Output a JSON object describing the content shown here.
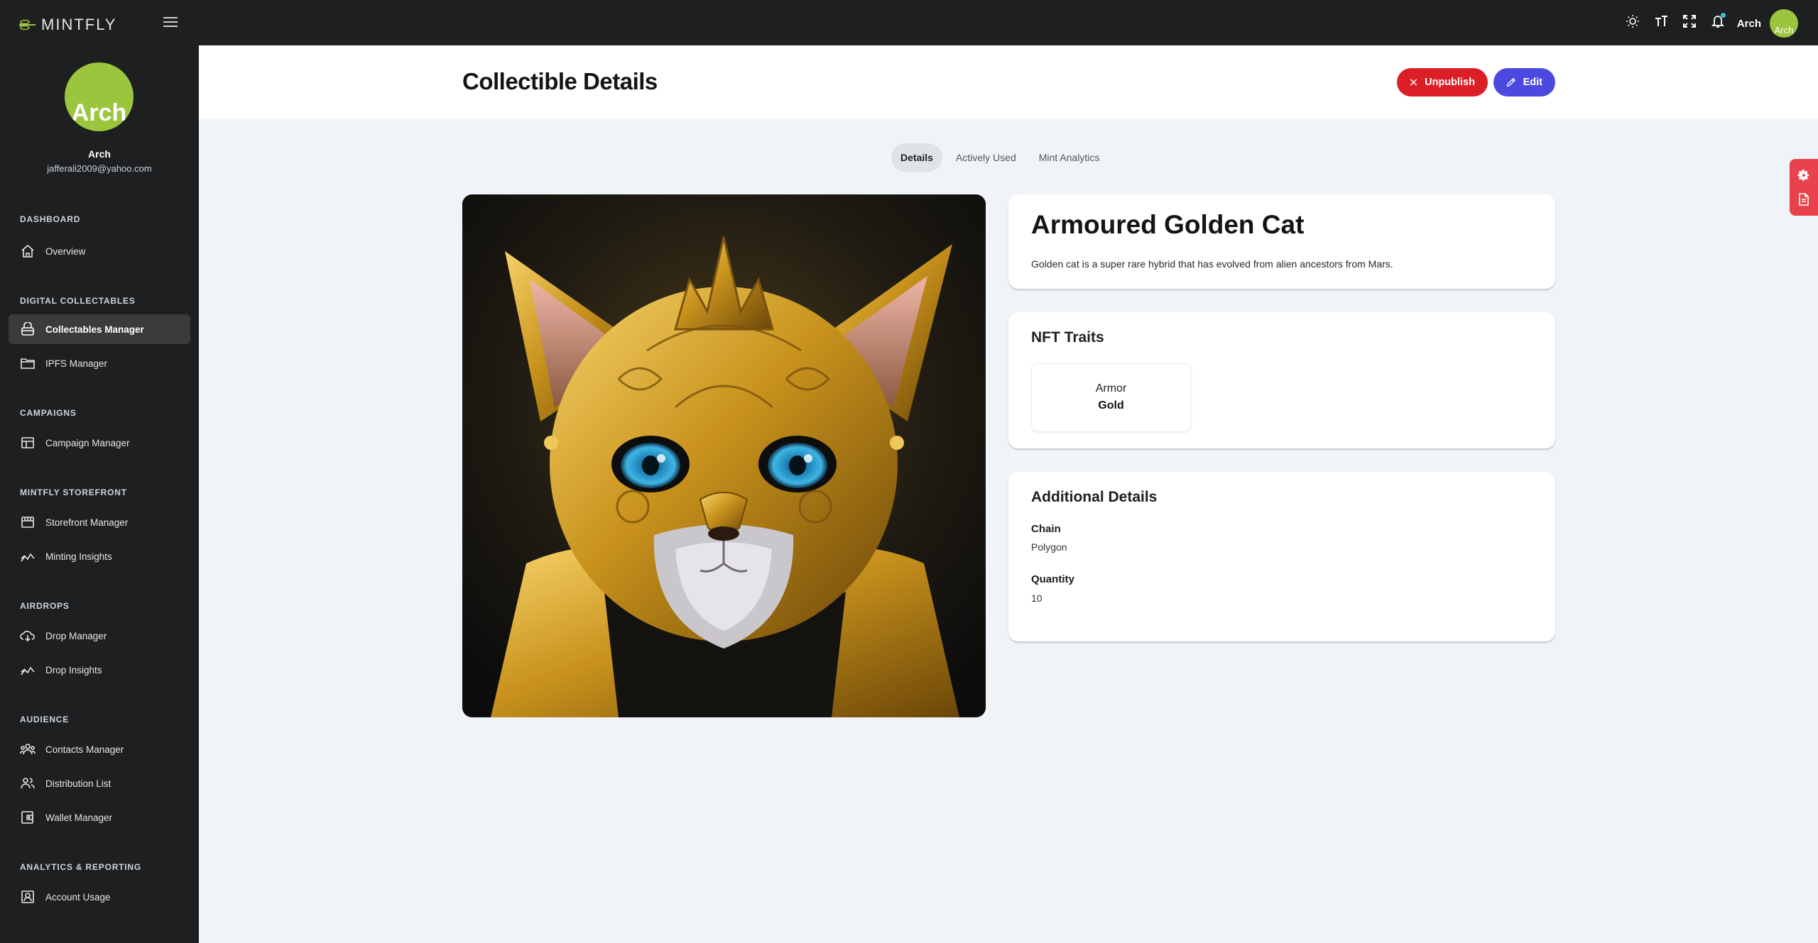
{
  "app": {
    "logo_text": "MINTFLY"
  },
  "topbar": {
    "user_name": "Arch",
    "avatar_text": "Arch"
  },
  "sidebar": {
    "avatar_text": "Arch",
    "user_name": "Arch",
    "user_email": "jafferali2009@yahoo.com",
    "sections": {
      "dashboard": "DASHBOARD",
      "digital_collectables": "DIGITAL COLLECTABLES",
      "campaigns": "CAMPAIGNS",
      "mintfly_storefront": "MINTFLY STOREFRONT",
      "airdrops": "AIRDROPS",
      "audience": "AUDIENCE",
      "analytics_reporting": "ANALYTICS & REPORTING"
    },
    "items": {
      "overview": "Overview",
      "collectables_manager": "Collectables Manager",
      "ipfs_manager": "IPFS Manager",
      "campaign_manager": "Campaign Manager",
      "storefront_manager": "Storefront Manager",
      "minting_insights": "Minting Insights",
      "drop_manager": "Drop Manager",
      "drop_insights": "Drop Insights",
      "contacts_manager": "Contacts Manager",
      "distribution_list": "Distribution List",
      "wallet_manager": "Wallet Manager",
      "account_usage": "Account Usage"
    },
    "active_item": "collectables_manager"
  },
  "header": {
    "title": "Collectible Details",
    "unpublish_label": "Unpublish",
    "edit_label": "Edit"
  },
  "tabs": [
    {
      "label": "Details",
      "active": true
    },
    {
      "label": "Actively Used",
      "active": false
    },
    {
      "label": "Mint Analytics",
      "active": false
    }
  ],
  "collectible": {
    "name": "Armoured Golden Cat",
    "description": "Golden cat is a super rare hybrid that has evolved from alien ancestors from Mars.",
    "image_subject": "golden-armoured-cat"
  },
  "traits": {
    "title": "NFT Traits",
    "items": [
      {
        "type": "Armor",
        "value": "Gold"
      }
    ]
  },
  "details": {
    "title": "Additional Details",
    "chain_label": "Chain",
    "chain_value": "Polygon",
    "quantity_label": "Quantity",
    "quantity_value": "10"
  },
  "colors": {
    "sidebar_bg": "#1e1f20",
    "accent_green": "#9bc53d",
    "unpublish_red": "#dc1f26",
    "edit_blue": "#4c49e0",
    "content_bg": "#f0f3f7"
  }
}
